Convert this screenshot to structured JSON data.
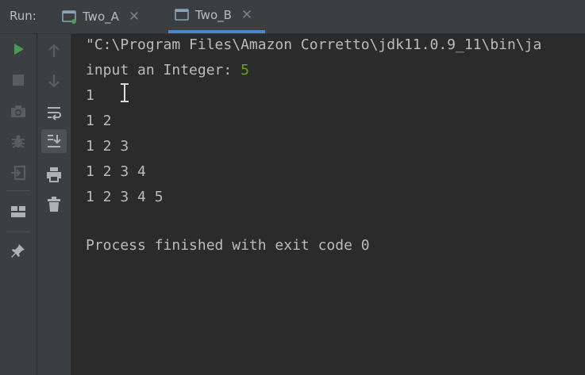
{
  "header": {
    "run_label": "Run:",
    "tabs": [
      {
        "label": "Two_A",
        "active": false,
        "close": "✕"
      },
      {
        "label": "Two_B",
        "active": true,
        "close": "✕"
      }
    ]
  },
  "left_toolbar": {
    "buttons": [
      "run-icon",
      "stop-icon",
      "camera-icon",
      "debug-icon",
      "exit-icon",
      "layout-icon",
      "pin-icon"
    ]
  },
  "second_toolbar": {
    "buttons": [
      "up-arrow-icon",
      "down-arrow-icon",
      "soft-wrap-icon",
      "scroll-to-end-icon",
      "print-icon",
      "trash-icon"
    ]
  },
  "console": {
    "command_line": "\"C:\\Program Files\\Amazon Corretto\\jdk11.0.9_11\\bin\\ja",
    "prompt": "input an Integer: ",
    "input_value": "5",
    "output_lines": [
      "1",
      "1 2",
      "1 2 3",
      "1 2 3 4",
      "1 2 3 4 5"
    ],
    "finish_message": "Process finished with exit code 0"
  },
  "colors": {
    "background": "#2b2b2b",
    "toolbar": "#3c3f41",
    "text": "#bbbbbb",
    "input_green": "#6a9f1a",
    "run_green": "#499c54",
    "tab_accent": "#4a88c7"
  }
}
